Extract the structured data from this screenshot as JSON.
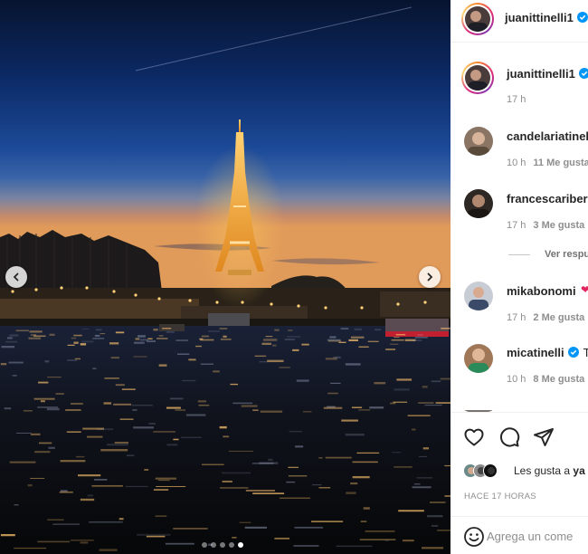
{
  "post": {
    "author": "juanittinelli1",
    "author_verified": true,
    "carousel": {
      "current": 5,
      "total": 5
    }
  },
  "caption": {
    "username": "juanittinelli1",
    "time": "17 h"
  },
  "comments": [
    {
      "username": "candelariatinel",
      "time": "10 h",
      "likes": "11 Me gusta",
      "avatar_color": "#7a6a5a"
    },
    {
      "username": "francescaribero",
      "time": "17 h",
      "likes": "3 Me gusta",
      "avatar_color": "#3b3530"
    },
    {
      "username": "mikabonomi",
      "time": "17 h",
      "likes": "2 Me gusta",
      "avatar_color": "#5a6a80",
      "has_heart": true
    },
    {
      "username": "micatinelli",
      "verified": true,
      "text_start": "Te",
      "time": "10 h",
      "likes": "8 Me gusta",
      "avatar_color": "#9a7a60"
    }
  ],
  "view_replies": "Ver respu",
  "actions": {
    "like_icon": "heart-icon",
    "comment_icon": "comment-icon",
    "share_icon": "paper-plane-icon"
  },
  "likes_summary": {
    "prefix": "Les gusta a ",
    "name": "ya"
  },
  "timestamp": "HACE 17 HORAS",
  "add_comment": {
    "placeholder": "Agrega un come"
  },
  "colors": {
    "accent": "#0095f6",
    "text": "#262626",
    "muted": "#8e8e8e",
    "sky_top": "#081a4d",
    "sky_horizon": "#f0a060",
    "tower_light": "#f2b03a"
  }
}
